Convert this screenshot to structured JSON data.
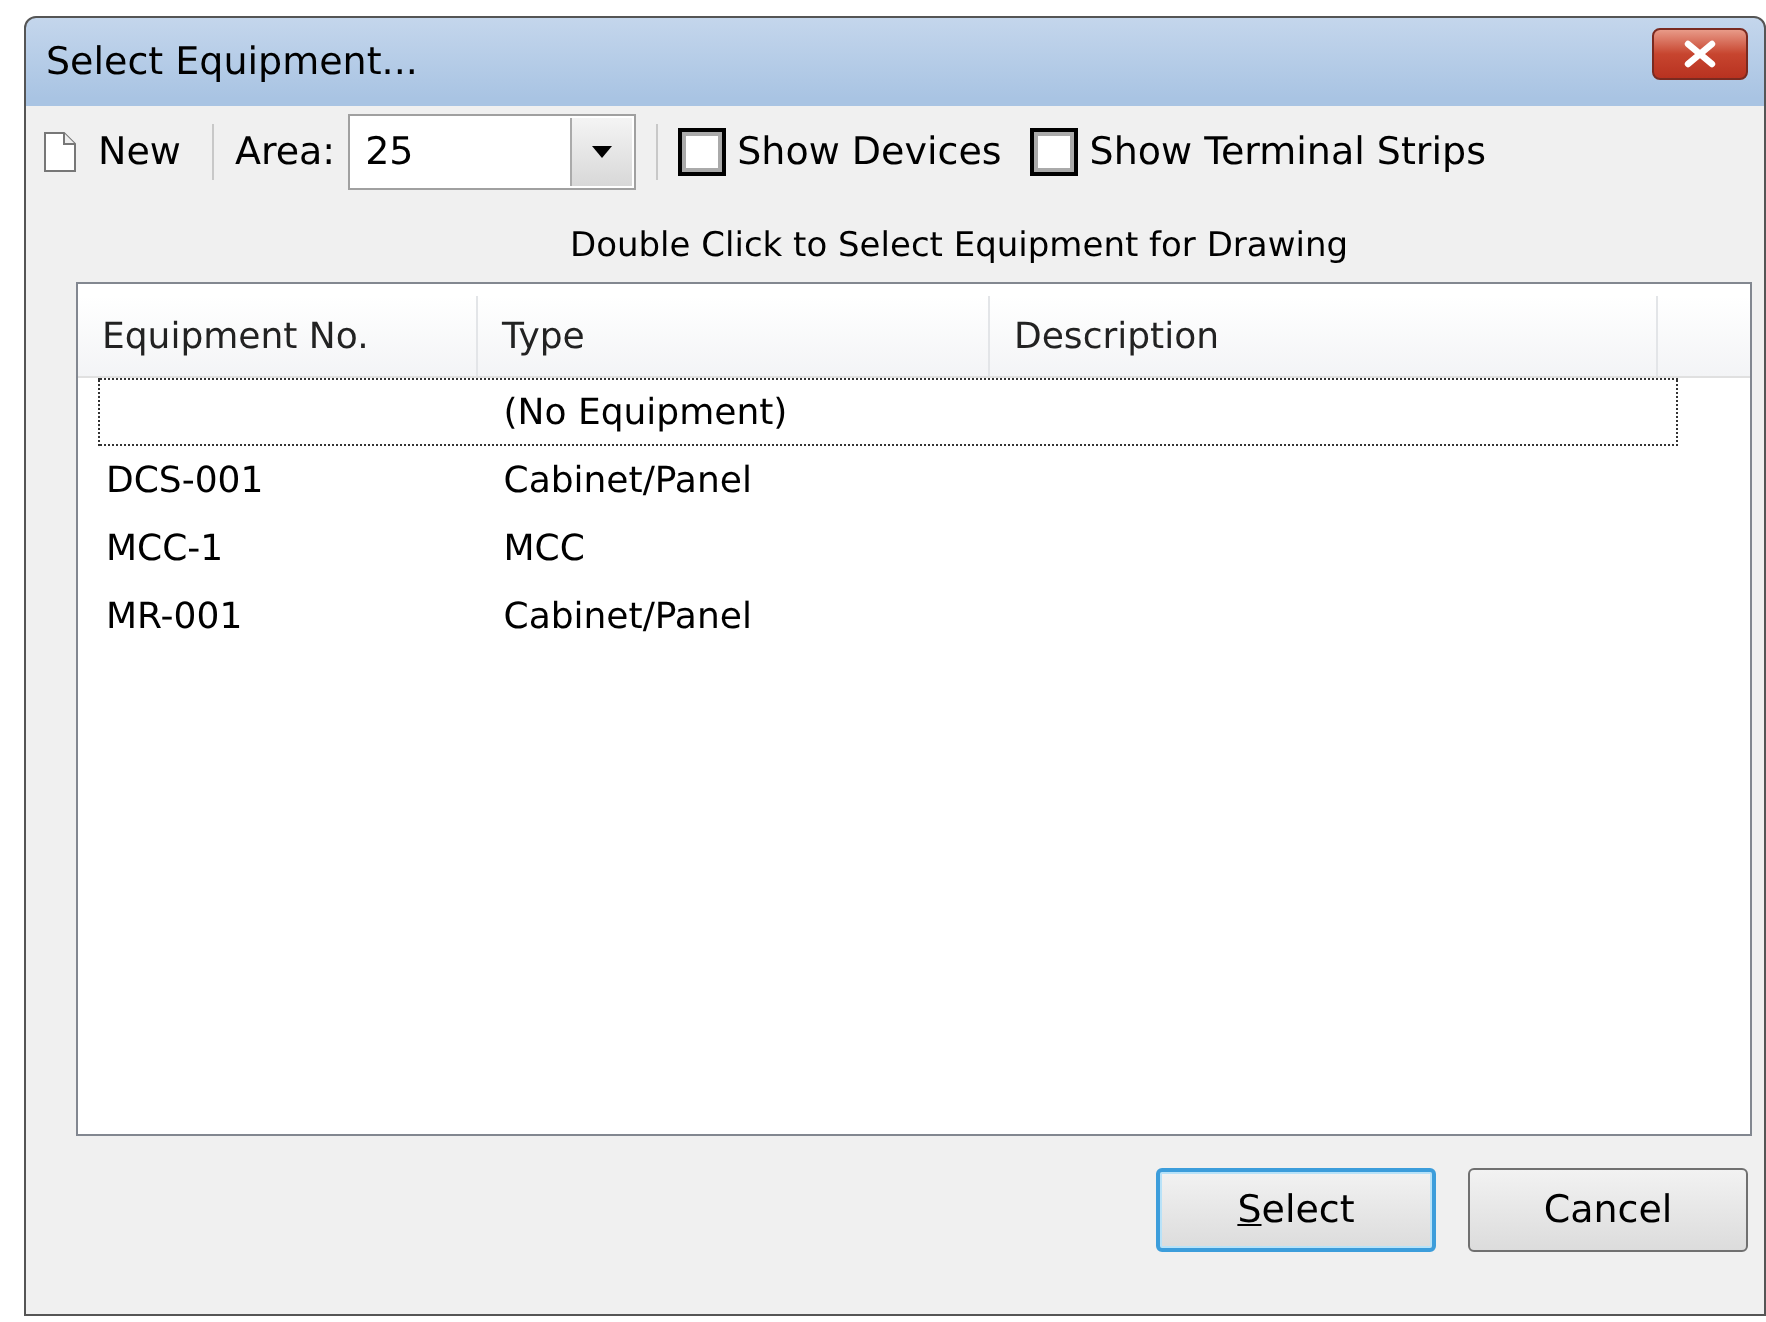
{
  "window": {
    "title": "Select Equipment..."
  },
  "toolbar": {
    "new_label": "New",
    "area_label": "Area:",
    "area_value": "25",
    "checkboxes": [
      {
        "label": "Show Devices",
        "checked": false
      },
      {
        "label": "Show Terminal Strips",
        "checked": false
      }
    ]
  },
  "caption": "Double Click to Select Equipment for Drawing",
  "table": {
    "columns": [
      "Equipment No.",
      "Type",
      "Description"
    ],
    "rows": [
      {
        "cells": [
          "",
          "(No Equipment)",
          ""
        ],
        "focused": true
      },
      {
        "cells": [
          "DCS-001",
          "Cabinet/Panel",
          ""
        ],
        "focused": false
      },
      {
        "cells": [
          "MCC-1",
          "MCC",
          ""
        ],
        "focused": false
      },
      {
        "cells": [
          "MR-001",
          "Cabinet/Panel",
          ""
        ],
        "focused": false
      }
    ]
  },
  "buttons": [
    {
      "label": "Select",
      "default": true,
      "mnemonic": true
    },
    {
      "label": "Cancel",
      "default": false,
      "mnemonic": false
    }
  ]
}
